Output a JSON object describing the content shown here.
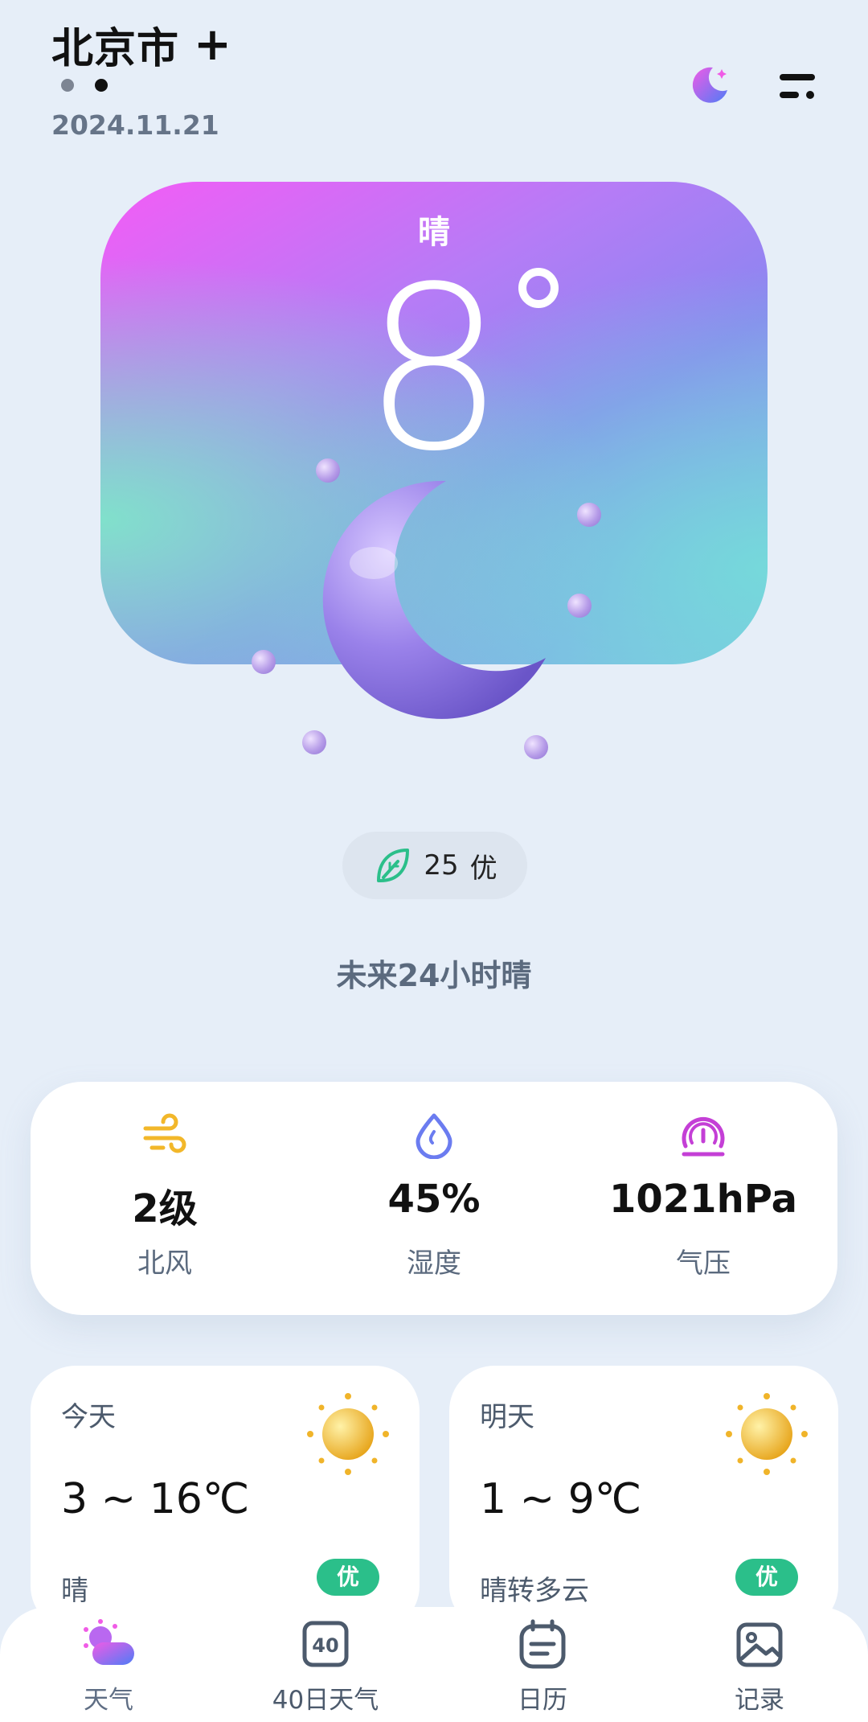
{
  "header": {
    "city": "北京市",
    "add_label": "+",
    "page_dots": [
      {
        "color": "#7d8593"
      },
      {
        "color": "#111111"
      }
    ],
    "date": "2024.11.21",
    "theme_icon": "moon-icon",
    "menu_icon": "menu-icon"
  },
  "hero": {
    "condition": "晴",
    "temperature": "8",
    "illustration": "moon-3d"
  },
  "aqi": {
    "value": "25",
    "level": "优",
    "icon": "leaf-icon",
    "color": "#2bbf8a"
  },
  "forecast_summary": "未来24小时晴",
  "stats": [
    {
      "icon": "wind-icon",
      "value": "2级",
      "label": "北风",
      "color": "#f2b72a"
    },
    {
      "icon": "humidity-icon",
      "value": "45%",
      "label": "湿度",
      "color": "#6b7cf0"
    },
    {
      "icon": "pressure-icon",
      "value": "1021hPa",
      "label": "气压",
      "color": "#c43fd6"
    }
  ],
  "days": [
    {
      "name": "今天",
      "range": "3 ~ 16℃",
      "desc": "晴",
      "badge": "优",
      "icon": "sun-icon"
    },
    {
      "name": "明天",
      "range": "1 ~ 9℃",
      "desc": "晴转多云",
      "badge": "优",
      "icon": "sun-icon"
    }
  ],
  "nav": [
    {
      "label": "天气",
      "icon": "weather-icon",
      "active": true
    },
    {
      "label": "40日天气",
      "icon": "forty-day-icon",
      "icon_text": "40"
    },
    {
      "label": "日历",
      "icon": "calendar-icon"
    },
    {
      "label": "记录",
      "icon": "gallery-icon"
    }
  ],
  "colors": {
    "background": "#e6eef8",
    "badge_green": "#2bbf8a",
    "text_muted": "#5b6a7e"
  }
}
